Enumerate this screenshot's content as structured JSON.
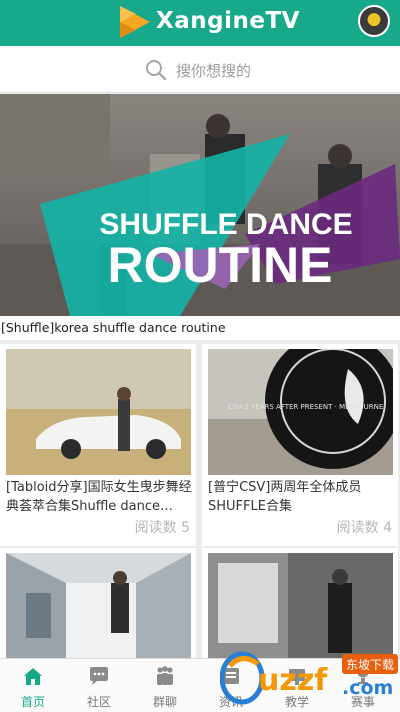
{
  "header": {
    "logo_text": "XangineTV",
    "avatar": "user-avatar"
  },
  "search": {
    "placeholder": "搜你想搜的"
  },
  "hero": {
    "title_line1": "SHUFFLE DANCE",
    "title_line2": "ROUTINE",
    "caption": "[Shuffle]korea shuffle dance routine"
  },
  "cards": [
    {
      "title": "[Tabloid分享]国际女生曳步舞经典荟萃合集Shuffle dance…",
      "reads": "阅读数 5"
    },
    {
      "title": "[普宁CSV]两周年全体成员SHUFFLE合集",
      "reads": "阅读数 4",
      "thumb_text": "CSV 2 YEARS AFTER PRESENT · MELBOURNE"
    },
    {
      "title": "",
      "reads": ""
    },
    {
      "title": "",
      "reads": ""
    }
  ],
  "tabs": [
    {
      "label": "首页",
      "icon": "home-icon",
      "active": true
    },
    {
      "label": "社区",
      "icon": "chat-icon",
      "active": false
    },
    {
      "label": "群聊",
      "icon": "group-icon",
      "active": false
    },
    {
      "label": "资讯",
      "icon": "news-icon",
      "active": false
    },
    {
      "label": "教学",
      "icon": "teach-icon",
      "active": false
    },
    {
      "label": "赛事",
      "icon": "trophy-icon",
      "active": false
    }
  ],
  "watermark": {
    "text": "uzzf",
    "badge": "东坡下载",
    "suffix": ".com"
  },
  "colors": {
    "brand": "#17a98a",
    "watermark_orange": "#f39800",
    "watermark_blue": "#2a7fd4"
  }
}
